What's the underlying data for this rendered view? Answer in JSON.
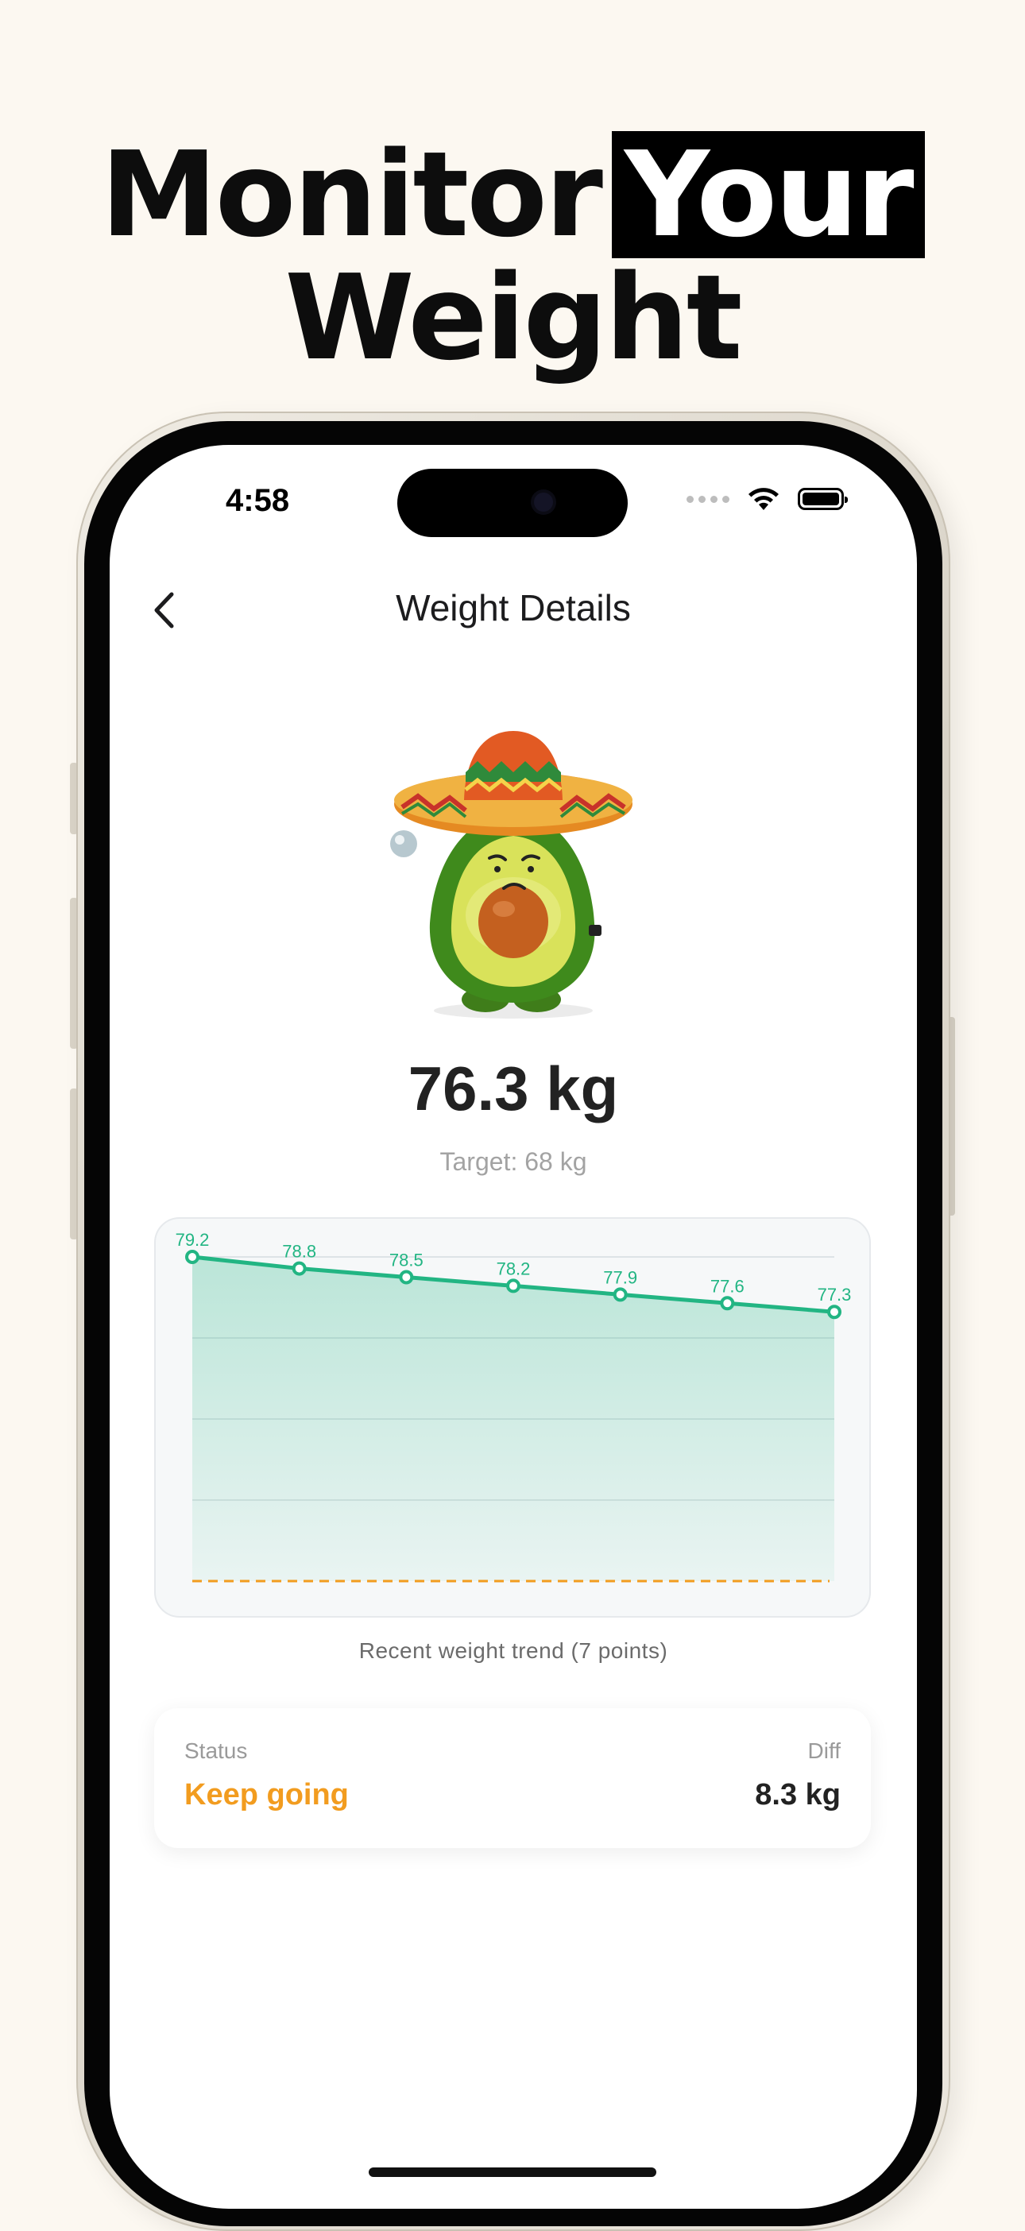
{
  "headline": {
    "word1": "Monitor",
    "word2_highlight": "Your",
    "line2": "Weight"
  },
  "status_bar": {
    "time": "4:58"
  },
  "nav": {
    "title": "Weight Details",
    "back_icon": "chevron-left-icon"
  },
  "summary": {
    "current_weight": "76.3 kg",
    "target_text": "Target: 68 kg",
    "mascot": "avocado-sombrero-mascot"
  },
  "chart_data": {
    "type": "area",
    "x": [
      1,
      2,
      3,
      4,
      5,
      6,
      7
    ],
    "values": [
      79.2,
      78.8,
      78.5,
      78.2,
      77.9,
      77.6,
      77.3
    ],
    "labels": [
      "79.2",
      "78.8",
      "78.5",
      "78.2",
      "77.9",
      "77.6",
      "77.3"
    ],
    "target": 68,
    "ylim": [
      68,
      79.2
    ],
    "grid": true,
    "line_color": "#22b583",
    "target_line_color": "#f29c1f",
    "caption": "Recent weight trend (7 points)"
  },
  "status_card": {
    "status_label": "Status",
    "status_value": "Keep going",
    "diff_label": "Diff",
    "diff_value": "8.3 kg",
    "status_color": "#f29c1f"
  }
}
